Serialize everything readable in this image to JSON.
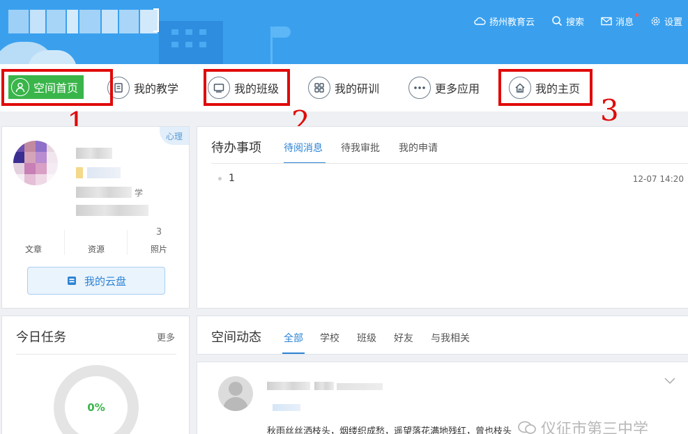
{
  "header": {
    "nav": [
      {
        "label": "扬州教育云",
        "icon": "cloud-icon"
      },
      {
        "label": "搜索",
        "icon": "search-icon"
      },
      {
        "label": "消息",
        "icon": "mail-icon"
      },
      {
        "label": "设置",
        "icon": "gear-icon"
      }
    ]
  },
  "menu": {
    "items": [
      {
        "label": "空间首页",
        "icon": "user-icon"
      },
      {
        "label": "我的教学",
        "icon": "notebook-icon"
      },
      {
        "label": "我的班级",
        "icon": "monitor-icon"
      },
      {
        "label": "我的研训",
        "icon": "grid-icon"
      },
      {
        "label": "更多应用",
        "icon": "ellipsis-icon"
      },
      {
        "label": "我的主页",
        "icon": "home-icon"
      }
    ],
    "annotations": [
      "1",
      "2",
      "3"
    ]
  },
  "profile": {
    "tag": "心理",
    "partial_label": "学",
    "stats": [
      {
        "value": "",
        "label": "文章"
      },
      {
        "value": "",
        "label": "资源"
      },
      {
        "value": "3",
        "label": "照片"
      }
    ],
    "cloud_button": "我的云盘"
  },
  "todo": {
    "title": "待办事项",
    "tabs": [
      "待阅消息",
      "待我审批",
      "我的申请"
    ],
    "items": [
      {
        "text": "1",
        "time": "12-07 14:20"
      }
    ]
  },
  "tasks": {
    "title": "今日任务",
    "more": "更多",
    "progress_label": "0%",
    "progress": 0
  },
  "feed": {
    "title": "空间动态",
    "tabs": [
      "全部",
      "学校",
      "班级",
      "好友",
      "与我相关"
    ],
    "post_text": "秋雨丝丝洒枝头，烟缕织成愁，遥望落花满地残红，曾也枝头"
  },
  "watermark": "仪征市第三中学",
  "colors": {
    "header_bg": "#3aa0ee",
    "active_menu": "#39b54a",
    "accent_blue": "#2c83d4",
    "annotation_red": "#e00a0a"
  }
}
